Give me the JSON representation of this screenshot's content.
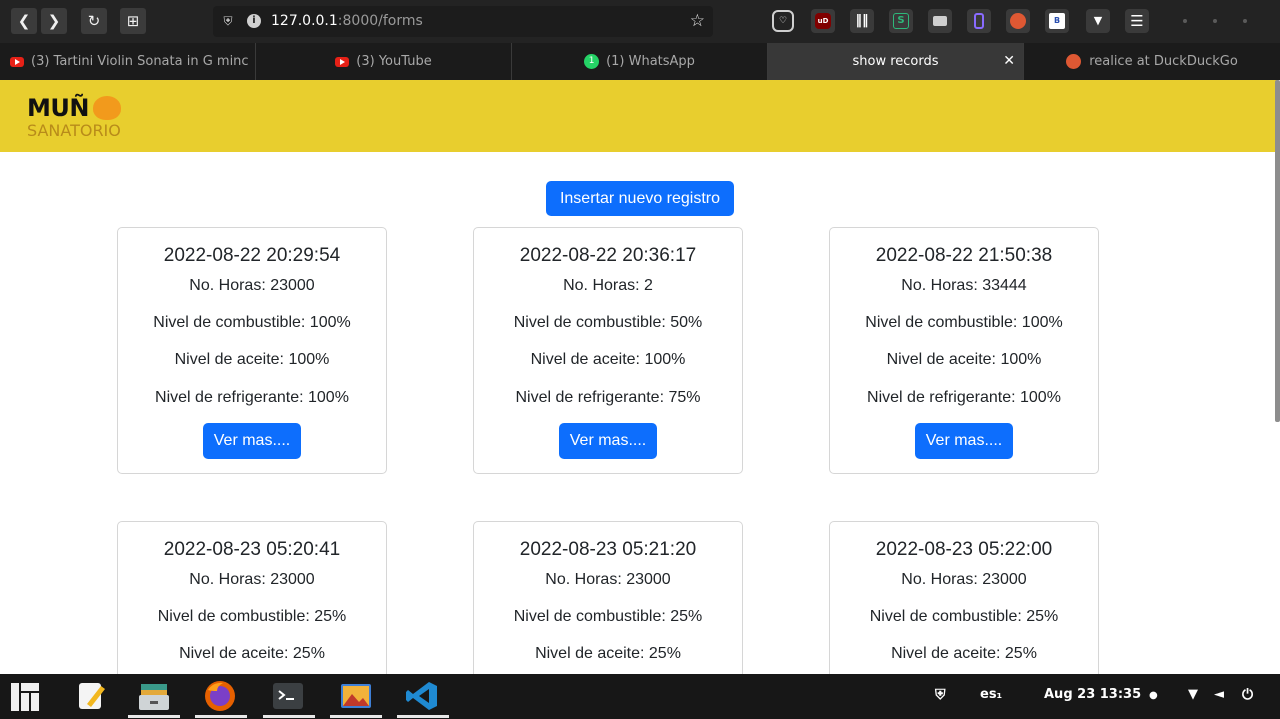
{
  "browser": {
    "url_host": "127.0.0.1",
    "url_path": ":8000/forms",
    "tabs": [
      {
        "label": "(3) Tartini Violin Sonata in G minc",
        "icon": "youtube-icon"
      },
      {
        "label": "(3) YouTube",
        "icon": "youtube-icon"
      },
      {
        "label": "(1) WhatsApp",
        "icon": "whatsapp-icon",
        "badge": "1"
      },
      {
        "label": "show records",
        "active": true
      },
      {
        "label": "realice at DuckDuckGo",
        "icon": "duckduckgo-icon"
      }
    ],
    "extension_labels": [
      "uD",
      "S",
      "B"
    ]
  },
  "site": {
    "logo_main": "MUÑ A",
    "logo_sub": "SANATORIO",
    "header_color": "#e8ce2e",
    "new_record_label": "Insertar nuevo registro"
  },
  "records": [
    {
      "date": "2022-08-22 20:29:54",
      "horas": "No. Horas: 23000",
      "combustible": "Nivel de combustible: 100%",
      "aceite": "Nivel de aceite: 100%",
      "refrigerante": "Nivel de refrigerante: 100%",
      "button": "Ver mas...."
    },
    {
      "date": "2022-08-22 20:36:17",
      "horas": "No. Horas: 2",
      "combustible": "Nivel de combustible: 50%",
      "aceite": "Nivel de aceite: 100%",
      "refrigerante": "Nivel de refrigerante: 75%",
      "button": "Ver mas...."
    },
    {
      "date": "2022-08-22 21:50:38",
      "horas": "No. Horas: 33444",
      "combustible": "Nivel de combustible: 100%",
      "aceite": "Nivel de aceite: 100%",
      "refrigerante": "Nivel de refrigerante: 100%",
      "button": "Ver mas...."
    },
    {
      "date": "2022-08-23 05:20:41",
      "horas": "No. Horas: 23000",
      "combustible": "Nivel de combustible: 25%",
      "aceite": "Nivel de aceite: 25%"
    },
    {
      "date": "2022-08-23 05:21:20",
      "horas": "No. Horas: 23000",
      "combustible": "Nivel de combustible: 25%",
      "aceite": "Nivel de aceite: 25%"
    },
    {
      "date": "2022-08-23 05:22:00",
      "horas": "No. Horas: 23000",
      "combustible": "Nivel de combustible: 25%",
      "aceite": "Nivel de aceite: 25%"
    }
  ],
  "taskbar": {
    "keyboard_layout": "es₁",
    "clock": "Aug 23  13:35"
  },
  "colors": {
    "primary": "#0d6efd",
    "toolbar": "#232323"
  }
}
